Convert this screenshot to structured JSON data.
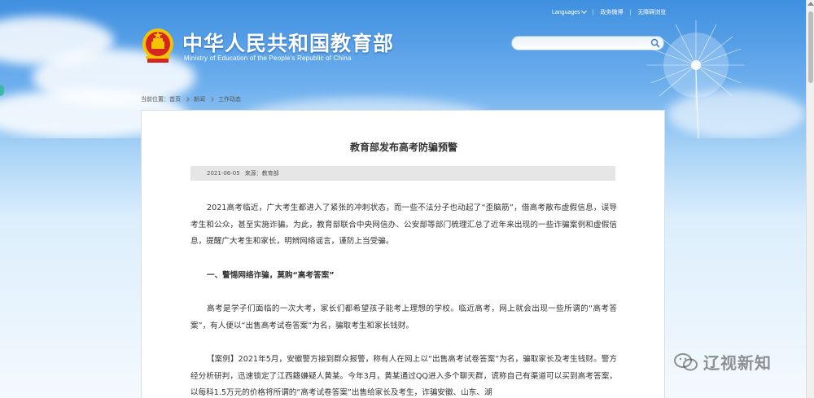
{
  "header": {
    "languages_label": "Languages",
    "link_mobile": "政务微博",
    "link_accessibility": "无障碍浏览",
    "title_cn": "中华人民共和国教育部",
    "title_en": "Ministry of Education of the People's Republic of China",
    "search_placeholder": ""
  },
  "breadcrumb": {
    "prefix": "当前位置：首页",
    "items": [
      "新闻",
      "工作动态"
    ]
  },
  "article": {
    "title": "教育部发布高考防骗预警",
    "date": "2021-06-05",
    "source": "来源：教育部",
    "para1": "2021高考临近，广大考生都进入了紧张的冲刺状态，而一些不法分子也动起了“歪脑筋”，借高考散布虚假信息，误导考生和公众，甚至实施诈骗。为此，教育部联合中央网信办、公安部等部门梳理汇总了近年来出现的一些诈骗案例和虚假信息，提醒广大考生和家长，明辨网络谣言，谨防上当受骗。",
    "section1": "一、警惕网络诈骗，莫购“高考答案”",
    "para2": "高考是学子们面临的一次大考，家长们都希望孩子能考上理想的学校。临近高考，网上就会出现一些所谓的“高考答案”，有人便以“出售高考试卷答案”为名，骗取考生和家长钱财。",
    "para3": "【案例】2021年5月，安徽警方接到群众报警，称有人在网上以“出售高考试卷答案”为名，骗取家长及考生钱财。警方经分析研判，迅速锁定了江西籍嫌疑人黄某。今年3月，黄某通过QQ进入多个聊天群，谎称自己有渠道可以买到高考答案，以每科1.5万元的价格将所谓的“高考试卷答案”出售给家长及考生，诈骗安徽、山东、湖"
  },
  "watermark": {
    "text": "辽视新知"
  },
  "colors": {
    "sky_top": "#3f8fe0",
    "emblem_red": "#d7261e",
    "emblem_gold": "#f5c400"
  }
}
